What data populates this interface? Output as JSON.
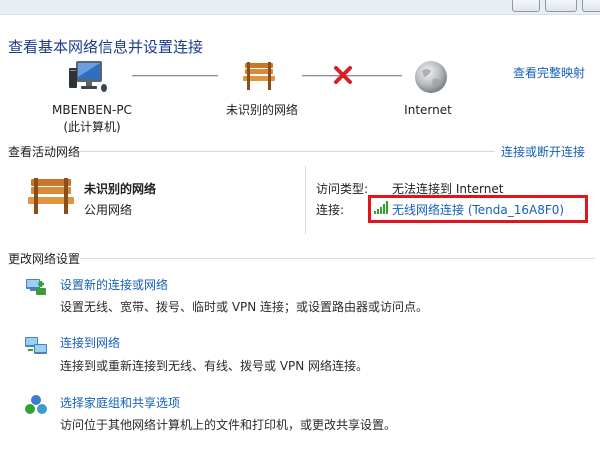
{
  "page_title": "查看基本网络信息并设置连接",
  "view_full_map": "查看完整映射",
  "map": {
    "computer_name": "MBENBEN-PC",
    "computer_note": "(此计算机)",
    "network_label": "未识别的网络",
    "internet_label": "Internet",
    "status_x_color": "#d6202a"
  },
  "active_networks": {
    "title": "查看活动网络",
    "action": "连接或断开连接",
    "network_name": "未识别的网络",
    "network_category": "公用网络",
    "access_type_label": "访问类型:",
    "access_type_value": "无法连接到 Internet",
    "connection_label": "连接:",
    "connection_value": "无线网络连接 (Tenda_16A8F0)",
    "highlight_color": "#e2131b"
  },
  "change_settings": {
    "title": "更改网络设置",
    "tasks": [
      {
        "title": "设置新的连接或网络",
        "desc": "设置无线、宽带、拨号、临时或 VPN 连接；或设置路由器或访问点。",
        "icon": "new-connection-icon"
      },
      {
        "title": "连接到网络",
        "desc": "连接到或重新连接到无线、有线、拨号或 VPN 网络连接。",
        "icon": "connect-network-icon"
      },
      {
        "title": "选择家庭组和共享选项",
        "desc": "访问位于其他网络计算机上的文件和打印机，或更改共享设置。",
        "icon": "homegroup-icon"
      }
    ]
  },
  "colors": {
    "link": "#1560b7",
    "title": "#1c3c8c"
  }
}
